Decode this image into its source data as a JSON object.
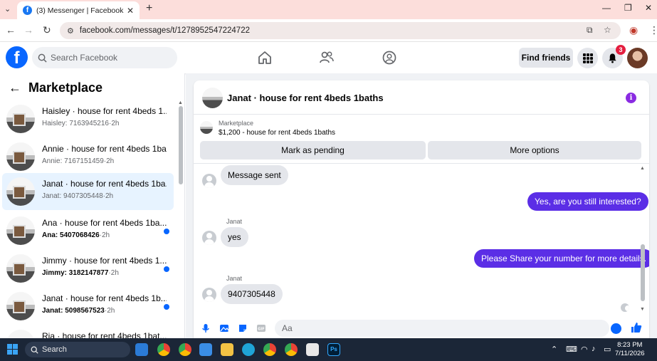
{
  "browser": {
    "tab_title": "(3) Messenger | Facebook",
    "url": "facebook.com/messages/t/1278952547224722"
  },
  "header": {
    "search_placeholder": "Search Facebook",
    "find_friends": "Find friends",
    "notification_count": "3",
    "logo_letter": "f"
  },
  "sidebar": {
    "title": "Marketplace",
    "conversations": [
      {
        "title": "Haisley · house for rent 4beds 1...",
        "sender": "Haisley:",
        "preview": "7163945216",
        "time": "2h",
        "unread": false,
        "active": false
      },
      {
        "title": "Annie · house for rent 4beds 1ba...",
        "sender": "Annie:",
        "preview": "7167151459",
        "time": "2h",
        "unread": false,
        "active": false
      },
      {
        "title": "Janat · house for rent 4beds 1ba...",
        "sender": "Janat:",
        "preview": "9407305448",
        "time": "2h",
        "unread": false,
        "active": true
      },
      {
        "title": "Ana · house for rent 4beds 1ba...",
        "sender": "Ana:",
        "preview": "5407068426",
        "time": "2h",
        "unread": true,
        "active": false
      },
      {
        "title": "Jimmy · house for rent 4beds 1...",
        "sender": "Jimmy:",
        "preview": "3182147877",
        "time": "2h",
        "unread": true,
        "active": false
      },
      {
        "title": "Janat · house for rent 4beds 1b...",
        "sender": "Janat:",
        "preview": "5098567523",
        "time": "2h",
        "unread": true,
        "active": false
      },
      {
        "title": "Ria · house for rent 4beds 1bat...",
        "sender": "",
        "preview": "",
        "time": "",
        "unread": false,
        "active": false
      }
    ]
  },
  "chat": {
    "title": "Janat · house for rent 4beds 1baths",
    "marketplace_label": "Marketplace",
    "listing": "$1,200 - house for rent 4beds 1baths",
    "mark_pending": "Mark as pending",
    "more_options": "More options",
    "messages": [
      {
        "dir": "in",
        "text": "Message sent",
        "sender": ""
      },
      {
        "dir": "out",
        "text": "Yes, are you still interested?"
      },
      {
        "dir": "in",
        "text": "yes",
        "sender": "Janat"
      },
      {
        "dir": "out",
        "text": "Please Share your number for more details."
      },
      {
        "dir": "in",
        "text": "9407305448",
        "sender": "Janat"
      }
    ],
    "composer_placeholder": "Aa"
  },
  "taskbar": {
    "search_label": "Search",
    "time": "8:23 PM",
    "date": "7/11/2026"
  },
  "colors": {
    "fb_blue": "#0866ff",
    "outgoing_bubble": "#5b2ee6",
    "active_conversation": "#e7f3ff",
    "notification_badge": "#e41e3f"
  }
}
